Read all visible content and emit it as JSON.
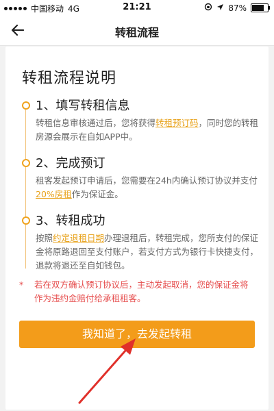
{
  "status_bar": {
    "carrier": "中国移动",
    "network": "4G",
    "time": "21:21",
    "battery": "87%",
    "battery_level": 0.87
  },
  "nav": {
    "title": "转租流程"
  },
  "content": {
    "title": "转租流程说明",
    "steps": [
      {
        "title": "1、填写转租信息",
        "desc_a": "转租信息审核通过后，您将获得",
        "highlight": "转租预订码",
        "desc_b": "，同时您的转租房源会展示在自如APP中。"
      },
      {
        "title": "2、完成预订",
        "desc_a": "租客发起预订申请后，您需要在24h内确认预订协议并支付",
        "highlight": "20%房租",
        "desc_b": "作为保证金。"
      },
      {
        "title": "3、转租成功",
        "desc_a": "按照",
        "highlight": "约定退租日期",
        "desc_b": "办理退租后，转租完成，您所支付的保证金将原路退回至支付账户，若支付方式为银行卡快捷支付，退款将退还至自如钱包。"
      }
    ],
    "warning_star": "*",
    "warning": "若在双方确认预订协议后，主动发起取消，您的保证金将作为违约金赔付给承租租客。",
    "button": "我知道了，去发起转租"
  },
  "colors": {
    "accent": "#f39c1a",
    "warning": "#e64d4d",
    "annotation_arrow": "#e0302a"
  }
}
